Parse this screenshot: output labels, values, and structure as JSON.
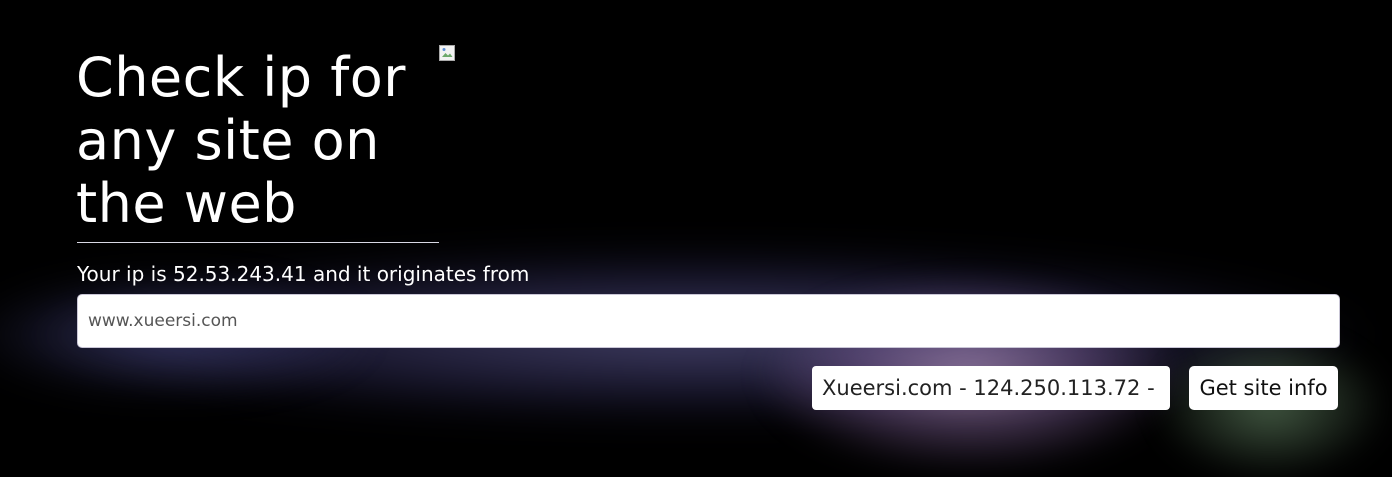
{
  "hero": {
    "title": "Check ip for any site on the web",
    "image_icon": "broken-image-icon"
  },
  "visitor": {
    "ip_text": "Your ip is 52.53.243.41 and it originates from"
  },
  "search": {
    "value": "",
    "placeholder": "www.xueersi.com"
  },
  "result": {
    "text": "Xueersi.com - 124.250.113.72 -"
  },
  "actions": {
    "get_info_label": "Get site info"
  },
  "colors": {
    "background": "#000000",
    "glow": "#7a75b8",
    "glow_accent": "#e0b8eb"
  }
}
